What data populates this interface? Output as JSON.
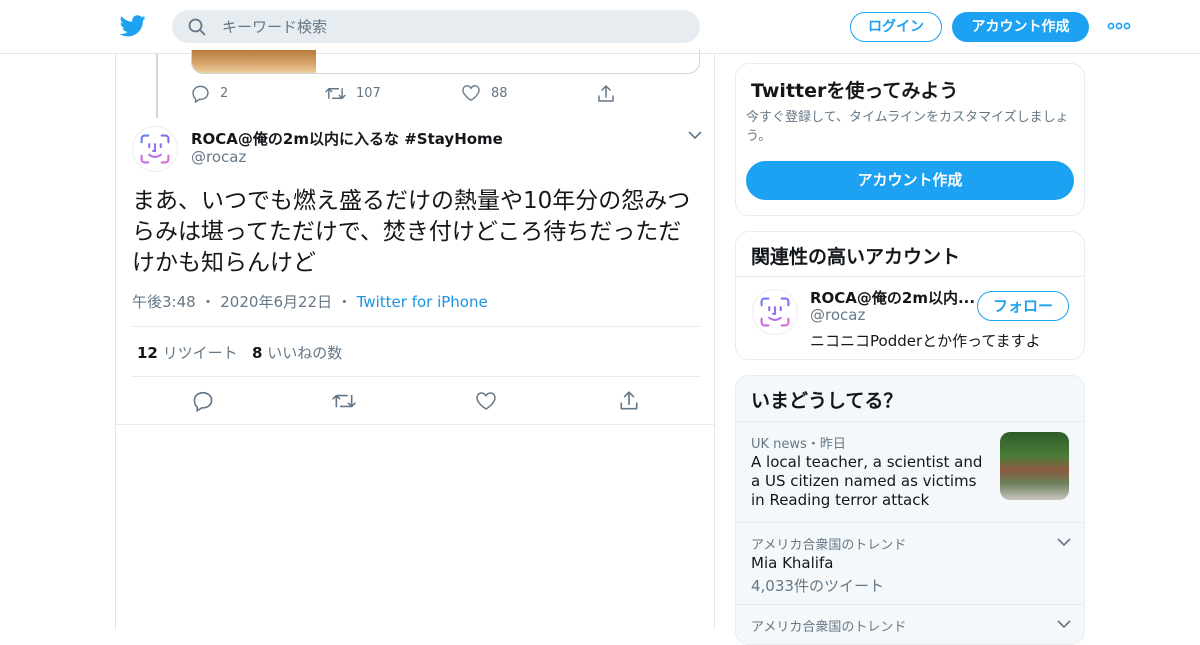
{
  "header": {
    "search_placeholder": "キーワード検索",
    "login_label": "ログイン",
    "signup_label": "アカウント作成"
  },
  "prev_tweet": {
    "reply_count": "2",
    "retweet_count": "107",
    "like_count": "88"
  },
  "tweet": {
    "display_name": "ROCA@俺の2m以内に入るな #StayHome",
    "handle": "@rocaz",
    "text": "まあ、いつでも燃え盛るだけの熱量や10年分の怨みつらみは堪ってただけで、焚き付けどころ待ちだっただけかも知らんけど",
    "time": "午後3:48",
    "date": "2020年6月22日",
    "source": "Twitter for iPhone",
    "retweets_num": "12",
    "retweets_label": "リツイート",
    "likes_num": "8",
    "likes_label": "いいねの数"
  },
  "signup_panel": {
    "title": "Twitterを使ってみよう",
    "subtitle": "今すぐ登録して、タイムラインをカスタマイズしましょう。",
    "button_label": "アカウント作成"
  },
  "related_panel": {
    "title": "関連性の高いアカウント",
    "name": "ROCA@俺の2m以内...",
    "handle": "@rocaz",
    "bio": "ニコニコPodderとか作ってますよ",
    "follow_label": "フォロー"
  },
  "trends_panel": {
    "title": "いまどうしてる？",
    "items": [
      {
        "context": "UK news・昨日",
        "title": "A local teacher, a scientist and a US citizen named as victims in Reading terror attack"
      },
      {
        "context": "アメリカ合衆国のトレンド",
        "title": "Mia Khalifa",
        "count": "4,033件のツイート"
      },
      {
        "context": "アメリカ合衆国のトレンド"
      }
    ]
  },
  "colors": {
    "accent": "#1da1f2",
    "text": "#14171a",
    "muted": "#657786",
    "border": "#e6ecf0"
  }
}
